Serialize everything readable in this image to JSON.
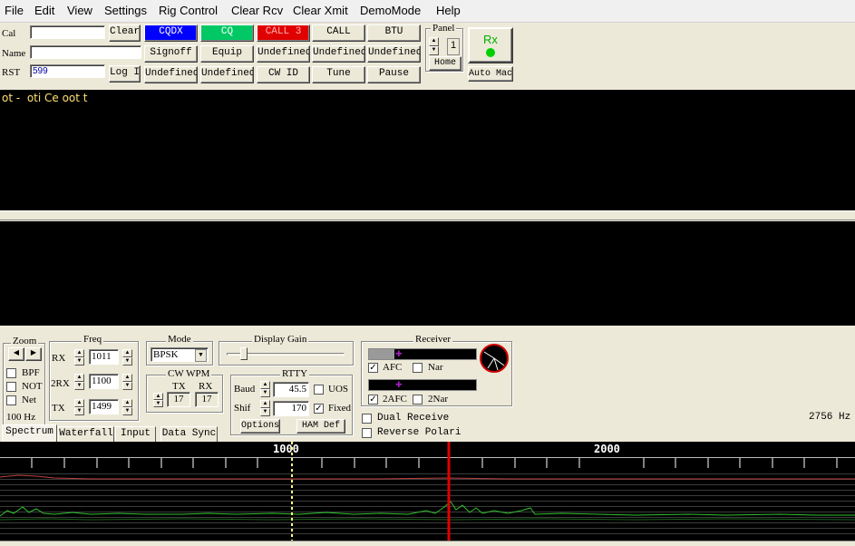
{
  "menu": [
    "File",
    "Edit",
    "View",
    "Settings",
    "Rig Control",
    "Clear Rcv",
    "Clear Xmit",
    "DemoMode",
    "Help"
  ],
  "fields": {
    "call_label": "Cal",
    "name_label": "Name",
    "rst_label": "RST",
    "call_value": "",
    "name_value": "",
    "rst_value": "599",
    "clear_label": "Clear",
    "log_label": "Log It"
  },
  "macros": {
    "row1": [
      "CQDX",
      "CQ",
      "CALL 3",
      "CALL",
      "BTU"
    ],
    "row2": [
      "Signoff",
      "Equip",
      "Undefined",
      "Undefined",
      "Undefined"
    ],
    "row3": [
      "Undefined",
      "Undefined",
      "CW ID",
      "Tune",
      "Pause"
    ]
  },
  "colors": {
    "cqdx": "#0000ff",
    "cq": "#00c864",
    "call3": "#e00000",
    "rx_green": "#00b000"
  },
  "panel": {
    "title": "Panel",
    "value": "1",
    "home_label": "Home"
  },
  "rx_button": {
    "label": "Rx",
    "auto_label": "Auto Mac"
  },
  "receive_text": "ot -  oti Ce oot t",
  "zoom": {
    "title": "Zoom",
    "bpf": "BPF",
    "notch": "NOT",
    "net": "Net",
    "hz": "100 Hz"
  },
  "freq": {
    "title": "Freq",
    "rx_label": "RX",
    "rx_value": "1011",
    "rx2_label": "2RX",
    "rx2_value": "1100",
    "tx_label": "TX",
    "tx_value": "1499"
  },
  "mode": {
    "title": "Mode",
    "value": "BPSK"
  },
  "cw": {
    "title": "CW WPM",
    "tx_label": "TX",
    "rx_label": "RX",
    "tx_value": "17",
    "rx_value": "17"
  },
  "display_gain": {
    "title": "Display Gain"
  },
  "rtty": {
    "title": "RTTY",
    "baud_label": "Baud",
    "baud_value": "45.5",
    "uos_label": "UOS",
    "shift_label": "Shif",
    "shift_value": "170",
    "fixed_label": "Fixed",
    "options_label": "Options",
    "ham_label": "HAM Def"
  },
  "receiver": {
    "title": "Receiver",
    "afc_label": "AFC",
    "nar_label": "Nar",
    "afc2_label": "2AFC",
    "nar2_label": "2Nar"
  },
  "dual_receive": "Dual Receive",
  "reverse_polarity": "Reverse Polari",
  "freq_readout": "2756 Hz",
  "tabs": [
    "Spectrum",
    "Waterfall",
    "Input",
    "Data Sync"
  ],
  "spectrum": {
    "scale_1000": "1000",
    "scale_2000": "2000"
  }
}
